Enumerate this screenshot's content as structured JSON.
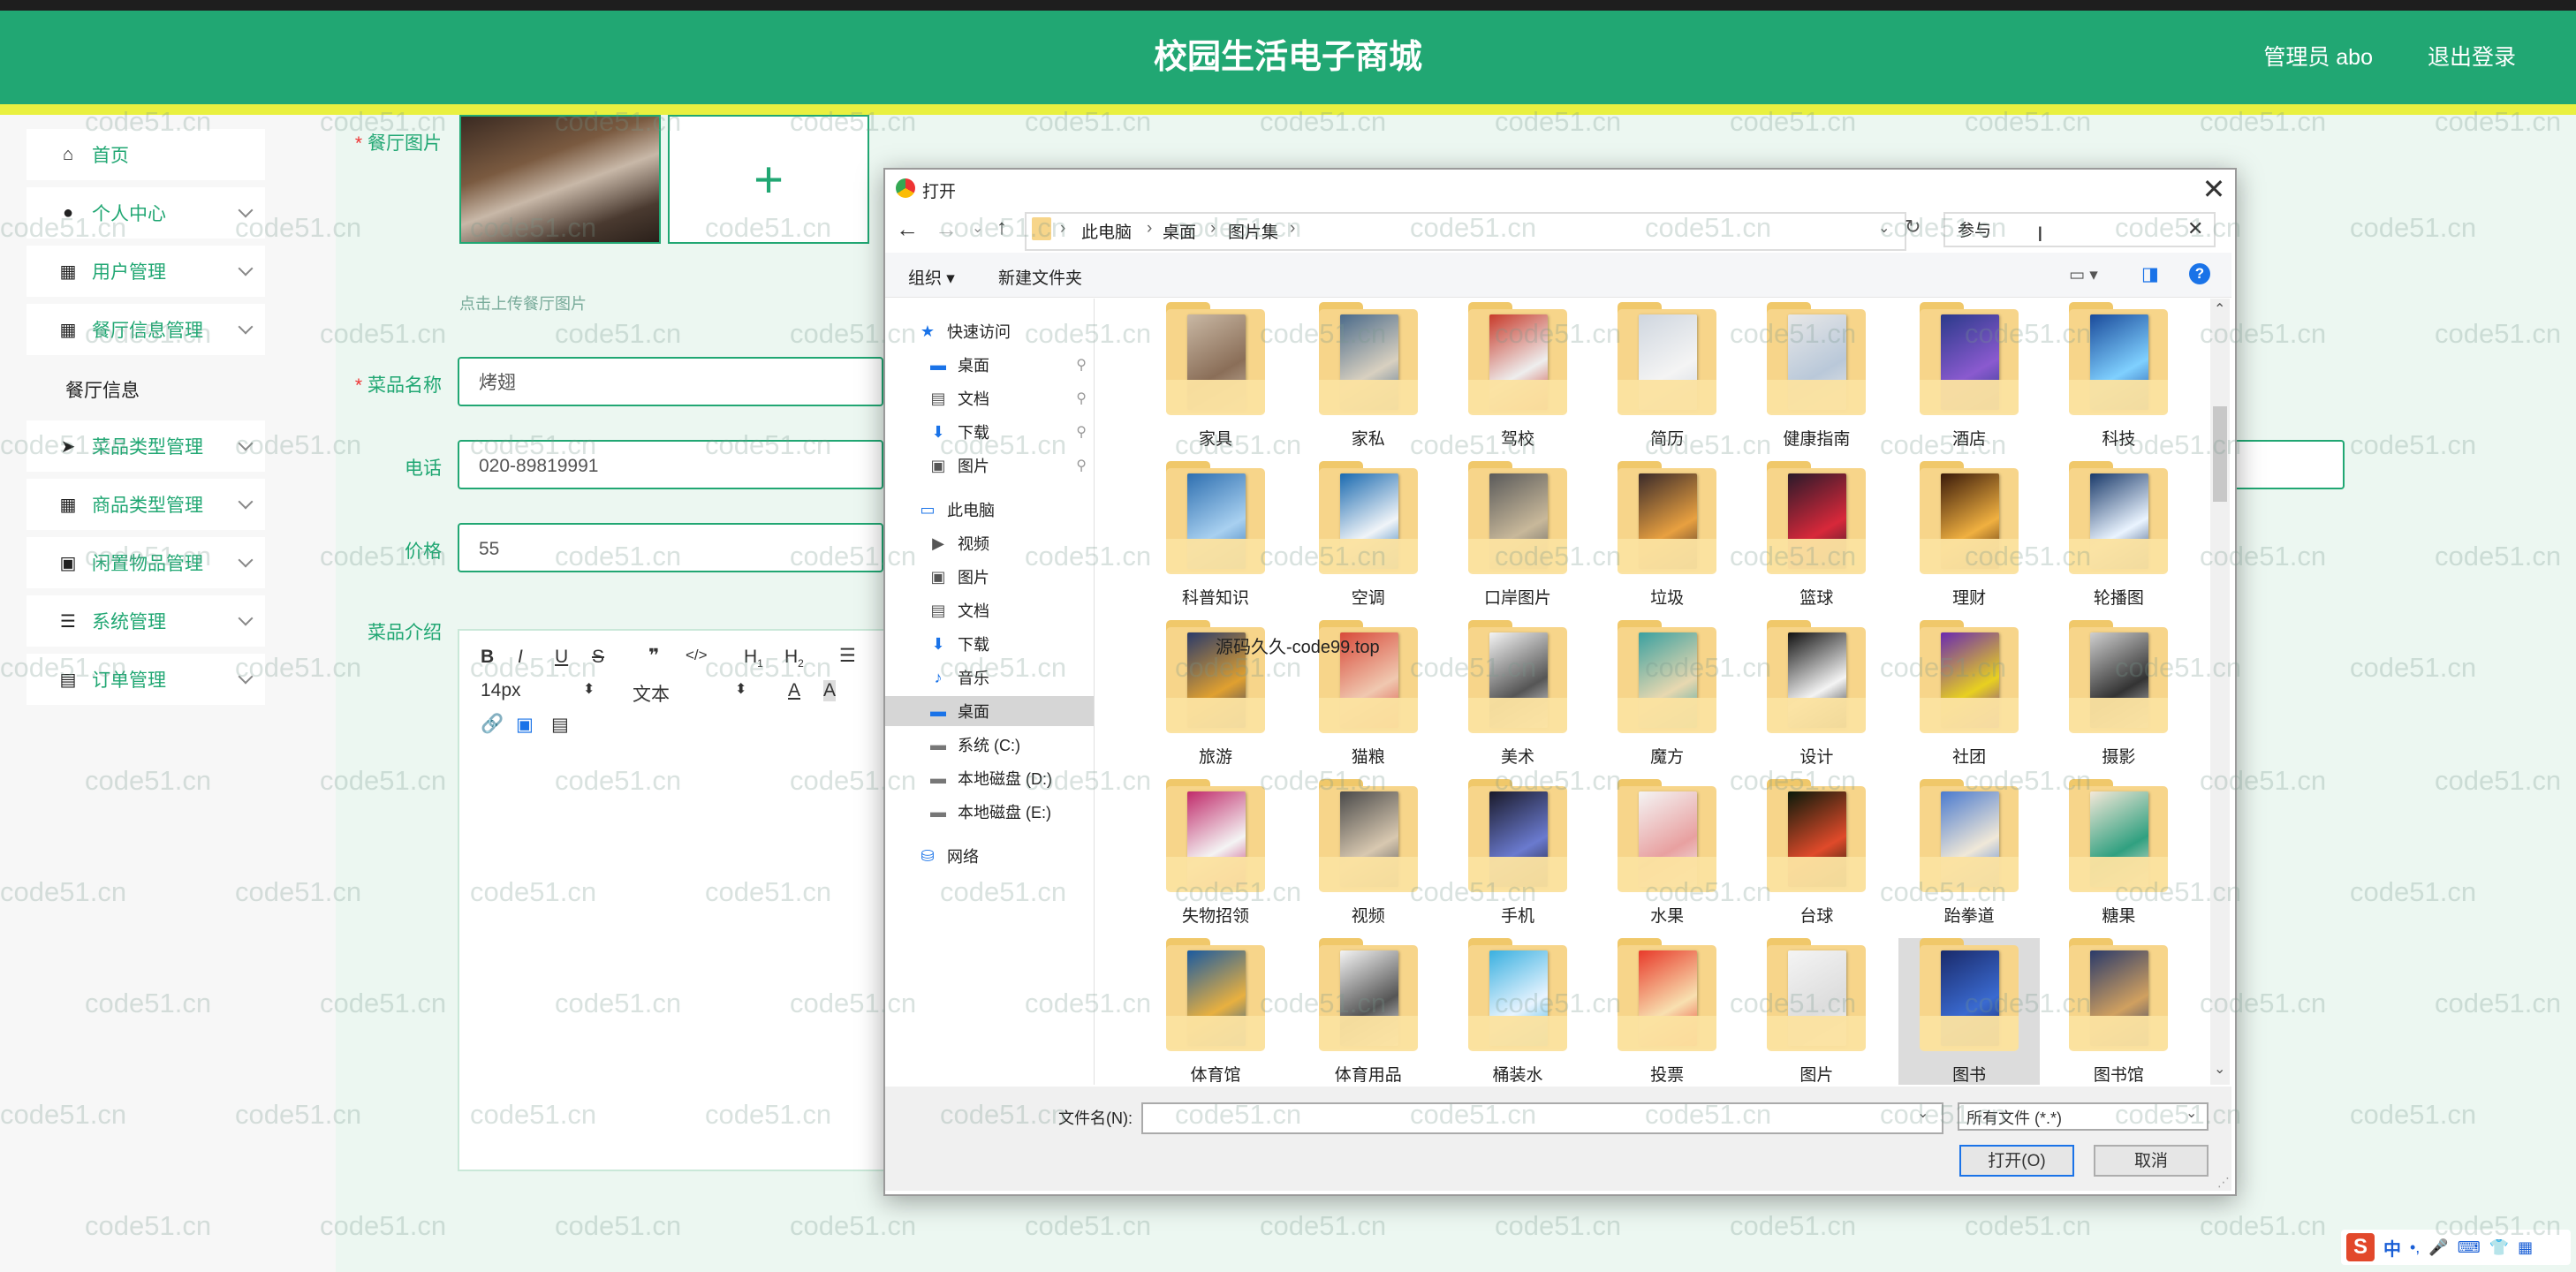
{
  "header": {
    "title": "校园生活电子商城",
    "admin": "管理员 abo",
    "logout": "退出登录"
  },
  "sidebar": {
    "items": [
      {
        "label": "首页",
        "icon": "home-icon"
      },
      {
        "label": "个人中心",
        "icon": "person-icon"
      },
      {
        "label": "用户管理",
        "icon": "grid-icon"
      },
      {
        "label": "餐厅信息管理",
        "icon": "grid-icon"
      },
      {
        "label": "菜品类型管理",
        "icon": "send-icon"
      },
      {
        "label": "商品类型管理",
        "icon": "grid-icon"
      },
      {
        "label": "闲置物品管理",
        "icon": "clipboard-icon"
      },
      {
        "label": "系统管理",
        "icon": "sliders-icon"
      },
      {
        "label": "订单管理",
        "icon": "chart-icon"
      }
    ],
    "sub_item": "餐厅信息"
  },
  "form": {
    "image_label": "餐厅图片",
    "upload_plus": "+",
    "upload_hint": "点击上传餐厅图片",
    "dish_label": "菜品名称",
    "dish_value": "烤翅",
    "phone_label": "电话",
    "phone_value": "020-89819991",
    "price_label": "价格",
    "price_value": "55",
    "intro_label": "菜品介绍",
    "font_size": "14px",
    "text_style": "文本"
  },
  "dialog": {
    "title": "打开",
    "breadcrumb": [
      "此电脑",
      "桌面",
      "图片集"
    ],
    "search_value": "参与",
    "toolbar": {
      "organize": "组织",
      "new_folder": "新建文件夹"
    },
    "nav": [
      {
        "label": "快速访问",
        "icon": "star-icon",
        "indent": false
      },
      {
        "label": "桌面",
        "icon": "desktop-icon",
        "indent": true,
        "pinned": true
      },
      {
        "label": "文档",
        "icon": "document-icon",
        "indent": true,
        "pinned": true
      },
      {
        "label": "下载",
        "icon": "download-icon",
        "indent": true,
        "pinned": true
      },
      {
        "label": "图片",
        "icon": "picture-icon",
        "indent": true,
        "pinned": true
      },
      {
        "label": "此电脑",
        "icon": "computer-icon",
        "indent": false
      },
      {
        "label": "视频",
        "icon": "video-icon",
        "indent": true
      },
      {
        "label": "图片",
        "icon": "picture-icon",
        "indent": true
      },
      {
        "label": "文档",
        "icon": "document-icon",
        "indent": true
      },
      {
        "label": "下载",
        "icon": "download-icon",
        "indent": true
      },
      {
        "label": "音乐",
        "icon": "music-icon",
        "indent": true
      },
      {
        "label": "桌面",
        "icon": "desktop-icon",
        "indent": true,
        "selected": true
      },
      {
        "label": "系统 (C:)",
        "icon": "drive-icon",
        "indent": true
      },
      {
        "label": "本地磁盘 (D:)",
        "icon": "drive-icon",
        "indent": true
      },
      {
        "label": "本地磁盘 (E:)",
        "icon": "drive-icon",
        "indent": true
      },
      {
        "label": "网络",
        "icon": "network-icon",
        "indent": false
      }
    ],
    "folders": [
      "家具",
      "家私",
      "驾校",
      "简历",
      "健康指南",
      "酒店",
      "科技",
      "科普知识",
      "空调",
      "口岸图片",
      "垃圾",
      "篮球",
      "理财",
      "轮播图",
      "旅游",
      "猫粮",
      "美术",
      "魔方",
      "设计",
      "社团",
      "摄影",
      "失物招领",
      "视频",
      "手机",
      "水果",
      "台球",
      "跆拳道",
      "糖果",
      "体育馆",
      "体育用品",
      "桶装水",
      "投票",
      "图片",
      "图书",
      "图书馆"
    ],
    "selected_folder": "图书",
    "filename_label": "文件名(N):",
    "filetype": "所有文件 (*.*)",
    "open_button": "打开(O)",
    "cancel_button": "取消"
  },
  "overlay_text": "源码久久-code99.top",
  "watermark": "code51.cn",
  "colors": {
    "primary": "#21a773",
    "stripe": "#e9f040",
    "background": "#ecf7f1",
    "folder": "#f7d58a"
  }
}
